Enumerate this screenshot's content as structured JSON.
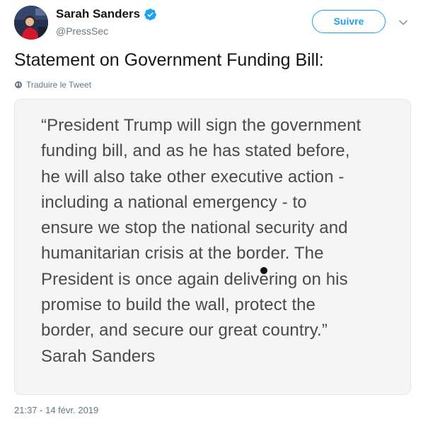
{
  "author": {
    "display_name": "Sarah Sanders",
    "handle": "@PressSec",
    "verified": true
  },
  "follow_button": {
    "label": "Suivre"
  },
  "tweet": {
    "text": "Statement on Government Funding Bill:",
    "translate_label": "Traduire le Tweet",
    "timestamp": "21:37 - 14 févr. 2019"
  },
  "media": {
    "statement_lines": [
      "“President Trump will sign the government",
      "funding bill, and as he has stated before,",
      "he will also take other executive action -",
      "including a national emergency - to",
      "ensure we stop the national security and",
      "humanitarian crisis at the border. The",
      "President is once again delivering on his",
      "promise to build the wall, protect the",
      "border, and secure our great country.”",
      "Sarah Sanders"
    ]
  },
  "icons": {
    "verified": "verified-badge-icon",
    "caret": "chevron-down-icon",
    "globe": "globe-icon"
  },
  "colors": {
    "accent": "#1da1f2",
    "secondary_text": "#657786",
    "card_background": "#f5f5f5"
  }
}
